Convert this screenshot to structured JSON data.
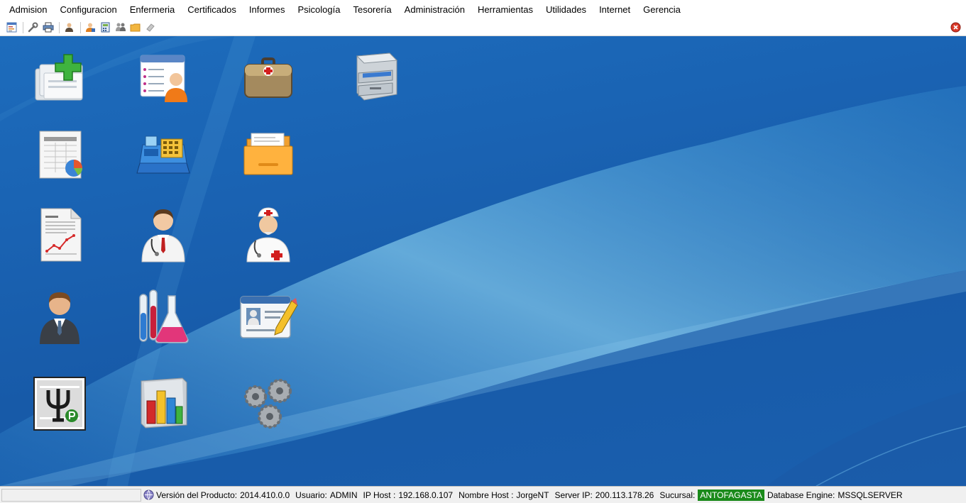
{
  "menu": [
    {
      "label": "Admision"
    },
    {
      "label": "Configuracion"
    },
    {
      "label": "Enfermeria"
    },
    {
      "label": "Certificados"
    },
    {
      "label": "Informes"
    },
    {
      "label": "Psicología"
    },
    {
      "label": "Tesorería"
    },
    {
      "label": "Administración"
    },
    {
      "label": "Herramientas"
    },
    {
      "label": "Utilidades"
    },
    {
      "label": "Internet"
    },
    {
      "label": "Gerencia"
    }
  ],
  "toolbar": {
    "buttons": [
      "form-icon",
      "wrench-icon",
      "printer-icon",
      "person-icon",
      "user-admin-icon",
      "calculator-icon",
      "users-group-icon",
      "folder-icon",
      "eraser-icon"
    ],
    "close_icon": "close-icon"
  },
  "desktop_icons": [
    [
      "new-records-icon",
      "patient-list-icon",
      "medical-kit-icon",
      "file-cabinet-icon"
    ],
    [
      "spreadsheet-chart-icon",
      "cash-register-icon",
      "folder-icon"
    ],
    [
      "report-icon",
      "doctor-icon",
      "nurse-icon"
    ],
    [
      "businessman-icon",
      "laboratory-icon",
      "id-card-edit-icon"
    ],
    [
      "psychology-icon",
      "bar-chart-icon",
      "gears-icon"
    ]
  ],
  "status": {
    "version_label": "Versión del Producto:",
    "version_value": "2014.410.0.0",
    "user_label": "Usuario:",
    "user_value": "ADMIN",
    "ip_label": "IP Host :",
    "ip_value": "192.168.0.107",
    "host_label": "Nombre Host :",
    "host_value": "JorgeNT",
    "server_label": "Server IP:",
    "server_value": "200.113.178.26",
    "branch_label": "Sucursal:",
    "branch_value": "ANTOFAGASTA",
    "engine_label": "Database Engine:",
    "engine_value": "MSSQLSERVER"
  },
  "colors": {
    "branch_badge": "#1a8a1a",
    "desktop": "#1a63b3"
  }
}
